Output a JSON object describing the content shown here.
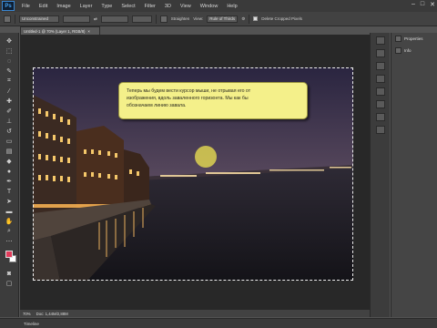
{
  "app": {
    "logo": "Ps"
  },
  "menu": [
    "File",
    "Edit",
    "Image",
    "Layer",
    "Type",
    "Select",
    "Filter",
    "3D",
    "View",
    "Window",
    "Help"
  ],
  "window_controls": {
    "minimize": "–",
    "restore": "□",
    "close": "✕"
  },
  "options": {
    "ratio": "Unconstrained",
    "straighten": "Straighten",
    "view_label": "View:",
    "view_value": "Rule of Thirds",
    "delete_cropped": "Delete Cropped Pixels"
  },
  "document": {
    "tab_title": "Untitled-1 @ 70% (Layer 1, RGB/8)",
    "tab_close": "×"
  },
  "tooltip": {
    "line1": "Теперь мы будем вести курсор мыши, не отрывая его от",
    "line2": "изображения, вдоль заваленного горизонта. Мы как бы",
    "line3": "обозначаем линию завала."
  },
  "status": {
    "zoom": "70%",
    "doc_size": "Doc: 1,44M/2,88M"
  },
  "timeline": "Timeline",
  "panels": [
    {
      "label": "Properties",
      "icon": "properties-icon"
    },
    {
      "label": "Info",
      "icon": "info-icon"
    }
  ],
  "colors": {
    "foreground": "#e13b5a",
    "background": "#ffffff",
    "tooltip_bg": "#f4f08a",
    "cursor_highlight": "#f0e650"
  }
}
